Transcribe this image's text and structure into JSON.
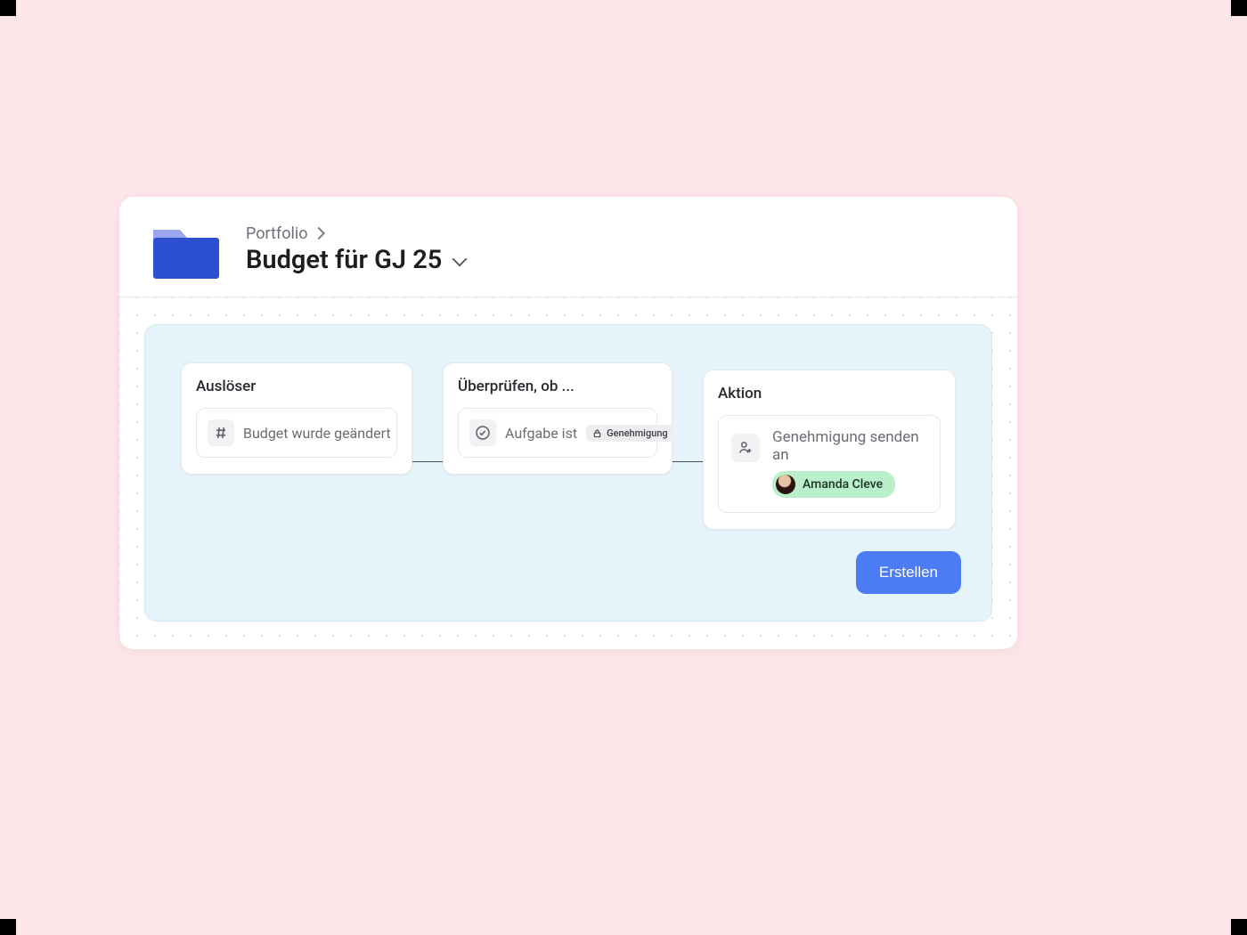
{
  "breadcrumb": {
    "parent": "Portfolio"
  },
  "page": {
    "title": "Budget für GJ 25"
  },
  "flow": {
    "trigger": {
      "heading": "Auslöser",
      "field_label": "Budget wurde geändert"
    },
    "check": {
      "heading": "Überprüfen, ob ...",
      "field_label": "Aufgabe ist",
      "pill_label": "Genehmigung"
    },
    "action": {
      "heading": "Aktion",
      "field_label": "Genehmigung senden an",
      "assignee_name": "Amanda Cleve"
    }
  },
  "buttons": {
    "create": "Erstellen"
  }
}
